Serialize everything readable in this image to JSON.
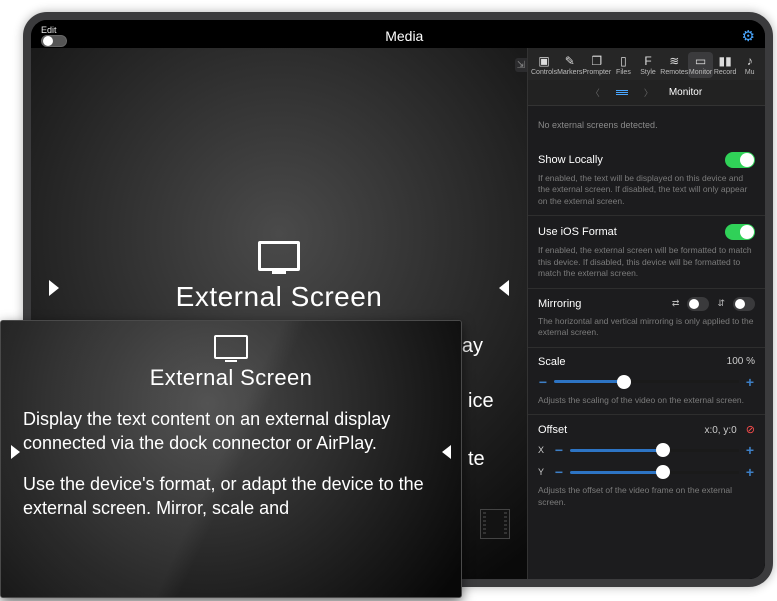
{
  "statusbar": {
    "edit_label": "Edit",
    "title": "Media"
  },
  "content": {
    "heading": "External Screen",
    "body": "Display the text content on an external display connected via the dock connector or"
  },
  "float": {
    "heading": "External Screen",
    "p1": "Display the text content on an external display connected via the dock connector or AirPlay.",
    "p2": "Use the device's format, or adapt the device to the external screen. Mirror, scale and",
    "side_hint1": "ice",
    "side_hint2": "te"
  },
  "toolbar": {
    "items": [
      "Controls",
      "Markers",
      "Prompter",
      "Files",
      "Style",
      "Remotes",
      "Monitor",
      "Record",
      "Mu"
    ]
  },
  "tabstrip": {
    "title": "Monitor"
  },
  "panel": {
    "notice": "No external screens detected.",
    "show_locally": {
      "label": "Show Locally",
      "desc": "If enabled, the text will be displayed on this device and the external screen. If disabled, the text will only appear on the external screen."
    },
    "ios_format": {
      "label": "Use iOS Format",
      "desc": "If enabled, the external screen will be formatted to match this device. If disabled, this device will be formatted to match the external screen."
    },
    "mirroring": {
      "label": "Mirroring",
      "desc": "The horizontal and vertical mirroring is only applied to the external screen."
    },
    "scale": {
      "label": "Scale",
      "value": "100 %",
      "desc": "Adjusts the scaling of the video on the external screen."
    },
    "offset": {
      "label": "Offset",
      "value": "x:0, y:0",
      "x_label": "X",
      "y_label": "Y",
      "desc": "Adjusts the offset of the video frame on the external screen."
    },
    "minus": "−",
    "plus": "+"
  }
}
